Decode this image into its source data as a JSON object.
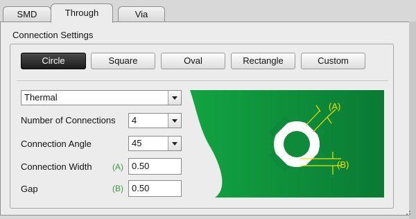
{
  "tabs": [
    {
      "label": "SMD",
      "active": false
    },
    {
      "label": "Through",
      "active": true
    },
    {
      "label": "Via",
      "active": false
    }
  ],
  "group": {
    "title": "Connection Settings"
  },
  "shape_buttons": [
    {
      "label": "Circle",
      "selected": true
    },
    {
      "label": "Square",
      "selected": false
    },
    {
      "label": "Oval",
      "selected": false
    },
    {
      "label": "Rectangle",
      "selected": false
    },
    {
      "label": "Custom",
      "selected": false
    }
  ],
  "style_select": {
    "value": "Thermal"
  },
  "fields": {
    "num_connections": {
      "label": "Number of Connections",
      "value": "4"
    },
    "connection_angle": {
      "label": "Connection Angle",
      "value": "45"
    },
    "connection_width": {
      "label": "Connection Width",
      "marker": "(A)",
      "value": "0.50"
    },
    "gap": {
      "label": "Gap",
      "marker": "(B)",
      "value": "0.50"
    }
  },
  "preview": {
    "label_a": "(A)",
    "label_b": "(B)",
    "bg_color": "#0e8a3c",
    "accent_color": "#f2e000"
  }
}
